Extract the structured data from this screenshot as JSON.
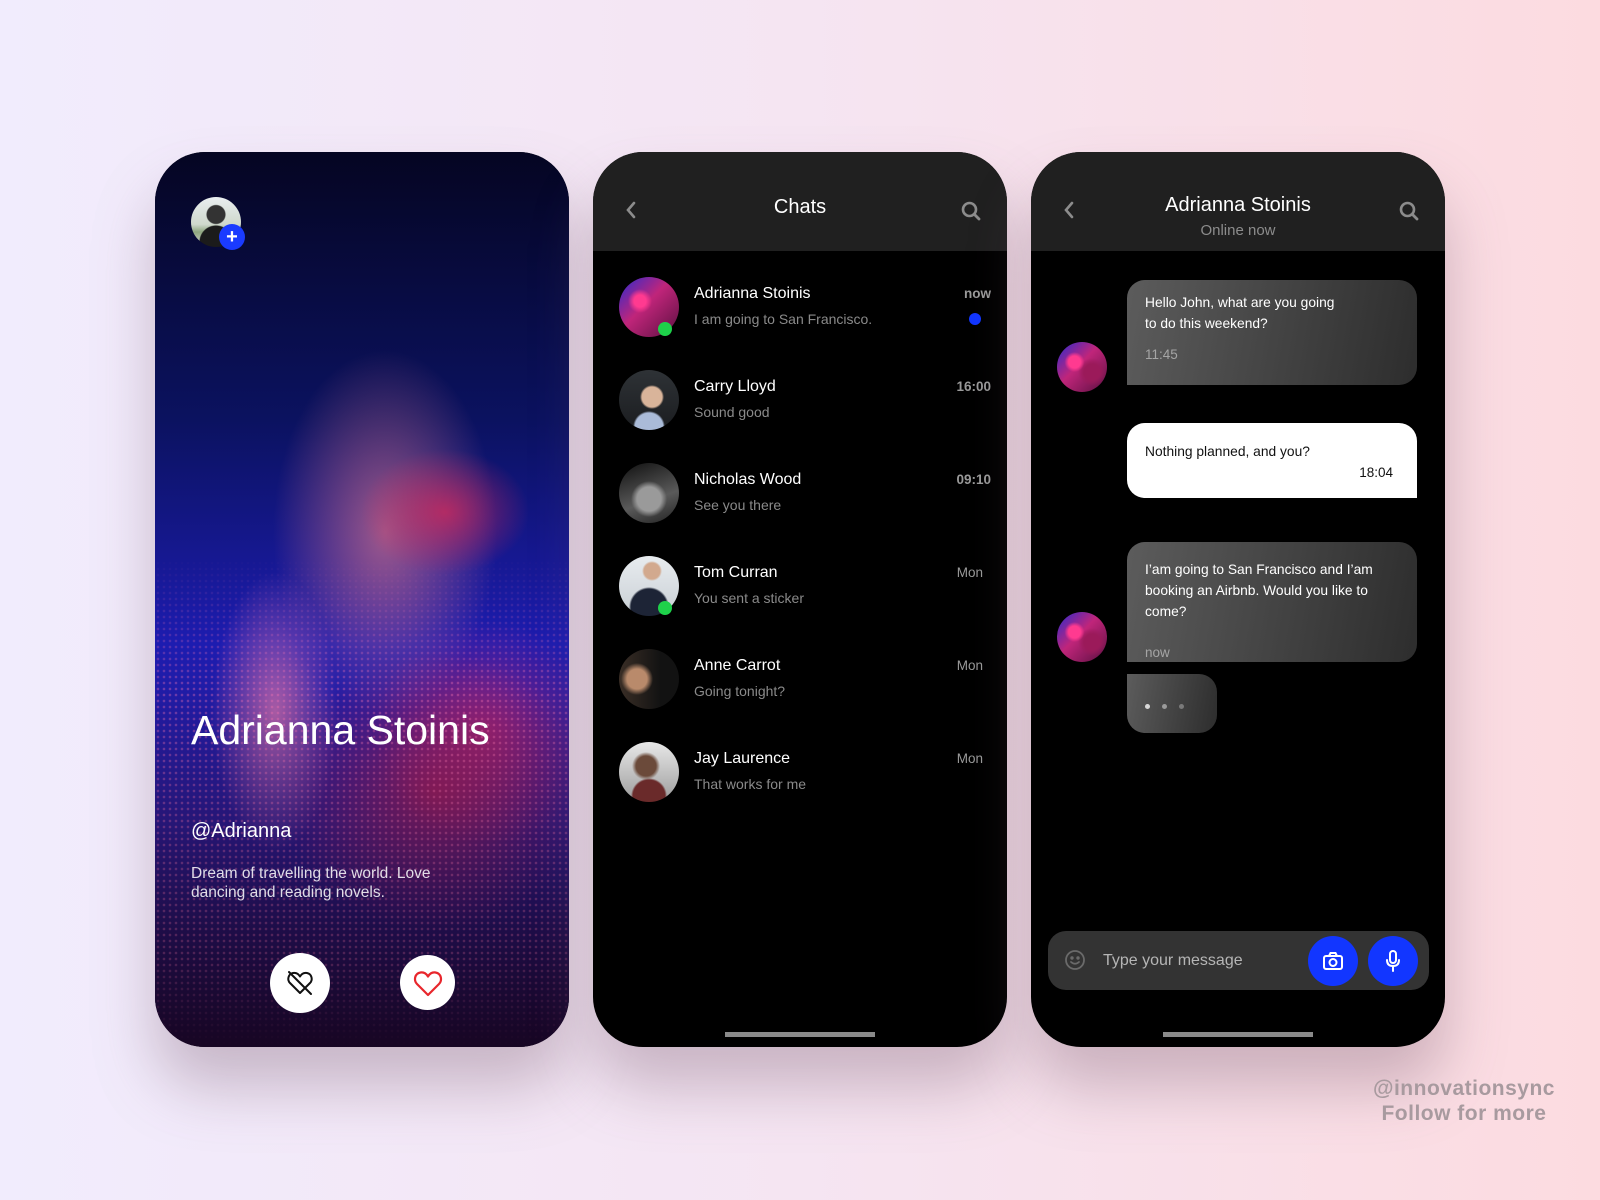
{
  "profile_screen": {
    "name": "Adrianna Stoinis",
    "handle": "@Adrianna",
    "bio": "Dream of travelling the world. Love dancing and reading novels.",
    "add_icon": "plus-icon",
    "actions": [
      {
        "name": "dislike",
        "icon": "broken-heart-icon"
      },
      {
        "name": "like",
        "icon": "heart-icon",
        "color": "#e8262c"
      }
    ]
  },
  "chats_screen": {
    "title": "Chats",
    "back_icon": "chevron-left-icon",
    "search_icon": "search-icon",
    "items": [
      {
        "name": "Adrianna Stoinis",
        "preview": "I am going to San Francisco.",
        "time": "now",
        "online": true,
        "unread": true
      },
      {
        "name": "Carry Lloyd",
        "preview": "Sound good",
        "time": "16:00",
        "online": false,
        "unread": false
      },
      {
        "name": "Nicholas Wood",
        "preview": "See you there",
        "time": "09:10",
        "online": false,
        "unread": false
      },
      {
        "name": "Tom Curran",
        "preview": "You sent a sticker",
        "time": "Mon",
        "online": true,
        "unread": false
      },
      {
        "name": "Anne Carrot",
        "preview": "Going tonight?",
        "time": "Mon",
        "online": false,
        "unread": false
      },
      {
        "name": "Jay Laurence",
        "preview": "That works for me",
        "time": "Mon",
        "online": false,
        "unread": false
      }
    ]
  },
  "conversation_screen": {
    "contact_name": "Adrianna Stoinis",
    "status": "Online now",
    "messages": [
      {
        "direction": "incoming",
        "text": "Hello John, what are you going\n to do this weekend?",
        "time": "11:45"
      },
      {
        "direction": "outgoing",
        "text": "Nothing planned, and you?",
        "time": "18:04"
      },
      {
        "direction": "incoming",
        "text": "I’am going to San Francisco and I’am booking an Airbnb. Would you like to come?",
        "time": "now"
      }
    ],
    "typing_indicator": true,
    "composer": {
      "placeholder": "Type your message",
      "value": "",
      "emoji_icon": "emoji-icon",
      "camera_icon": "camera-icon",
      "mic_icon": "microphone-icon"
    }
  },
  "colors": {
    "accent_blue": "#1236ff",
    "online_green": "#1ed14a",
    "like_red": "#e8262c"
  },
  "watermark": {
    "line1": "@innovationsync",
    "line2": "Follow for more"
  }
}
